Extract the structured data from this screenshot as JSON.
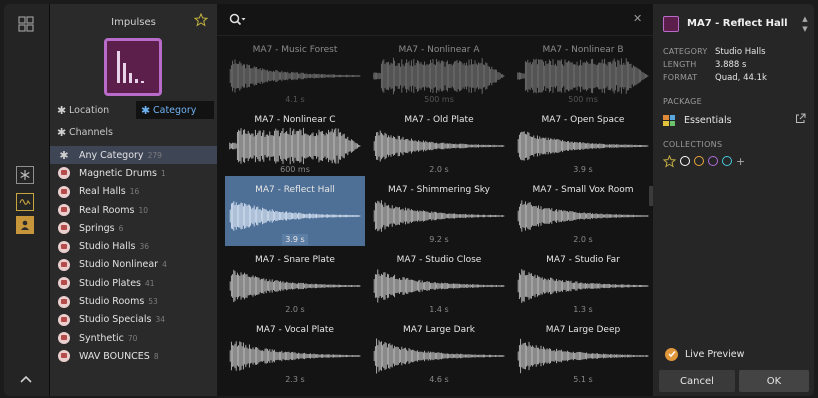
{
  "browser": {
    "title": "Impulses",
    "filters": {
      "location_label": "Location",
      "category_label": "Category",
      "channels_label": "Channels"
    },
    "categories": [
      {
        "label": "Any Category",
        "count": "279",
        "type": "any"
      },
      {
        "label": "Magnetic Drums",
        "count": "1"
      },
      {
        "label": "Real Halls",
        "count": "16"
      },
      {
        "label": "Real Rooms",
        "count": "10"
      },
      {
        "label": "Springs",
        "count": "6"
      },
      {
        "label": "Studio Halls",
        "count": "36"
      },
      {
        "label": "Studio Nonlinear",
        "count": "4"
      },
      {
        "label": "Studio Plates",
        "count": "41"
      },
      {
        "label": "Studio Rooms",
        "count": "53"
      },
      {
        "label": "Studio Specials",
        "count": "34"
      },
      {
        "label": "Synthetic",
        "count": "70"
      },
      {
        "label": "WAV BOUNCES",
        "count": "8"
      }
    ]
  },
  "search": {
    "placeholder": "",
    "value": ""
  },
  "results": [
    {
      "name": "MA7 - Music Forest",
      "length": "4.1 s",
      "shape": "decay",
      "faded": true
    },
    {
      "name": "MA7 - Nonlinear A",
      "length": "500 ms",
      "shape": "dense",
      "faded": true
    },
    {
      "name": "MA7 - Nonlinear B",
      "length": "500 ms",
      "shape": "dense",
      "faded": true
    },
    {
      "name": "MA7 - Nonlinear C",
      "length": "600 ms",
      "shape": "dense"
    },
    {
      "name": "MA7 - Old Plate",
      "length": "2.0 s",
      "shape": "decay"
    },
    {
      "name": "MA7 - Open Space",
      "length": "3.9 s",
      "shape": "decay"
    },
    {
      "name": "MA7 - Reflect Hall",
      "length": "3.9 s",
      "shape": "decay",
      "selected": true
    },
    {
      "name": "MA7 - Shimmering Sky",
      "length": "9.2 s",
      "shape": "decay"
    },
    {
      "name": "MA7 - Small Vox Room",
      "length": "2.0 s",
      "shape": "decay"
    },
    {
      "name": "MA7 - Snare Plate",
      "length": "2.0 s",
      "shape": "decay"
    },
    {
      "name": "MA7 - Studio Close",
      "length": "1.4 s",
      "shape": "decay"
    },
    {
      "name": "MA7 - Studio Far",
      "length": "1.3 s",
      "shape": "decay"
    },
    {
      "name": "MA7 - Vocal Plate",
      "length": "2.3 s",
      "shape": "decay"
    },
    {
      "name": "MA7 Large Dark",
      "length": "4.6 s",
      "shape": "decay"
    },
    {
      "name": "MA7 Large Deep",
      "length": "5.1 s",
      "shape": "decay"
    }
  ],
  "details": {
    "title": "MA7 - Reflect Hall",
    "meta": [
      {
        "key": "CATEGORY",
        "value": "Studio Halls"
      },
      {
        "key": "LENGTH",
        "value": "3.888 s"
      },
      {
        "key": "FORMAT",
        "value": "Quad, 44.1k"
      }
    ],
    "package_label": "PACKAGE",
    "package_name": "Essentials",
    "collections_label": "COLLECTIONS",
    "collection_colors": [
      "#ffffff",
      "#e9a53d",
      "#b06be0",
      "#46c7d9"
    ],
    "star_color": "#cbb443",
    "live_preview_label": "Live Preview",
    "cancel_label": "Cancel",
    "ok_label": "OK"
  },
  "colors": {
    "selection": "#4e6f96",
    "accent_blue": "#6fb2f2",
    "accent_orange": "#e0963a",
    "preset_art": "#b86bc8"
  },
  "icons": {
    "rail": [
      "grid-icon",
      "asterisk-box-icon",
      "waveform-box-icon",
      "user-box-icon",
      "chevron-up-icon"
    ],
    "category": "impulse-folder-icon",
    "search": "search-icon",
    "close": "close-icon",
    "external": "external-link-icon"
  }
}
